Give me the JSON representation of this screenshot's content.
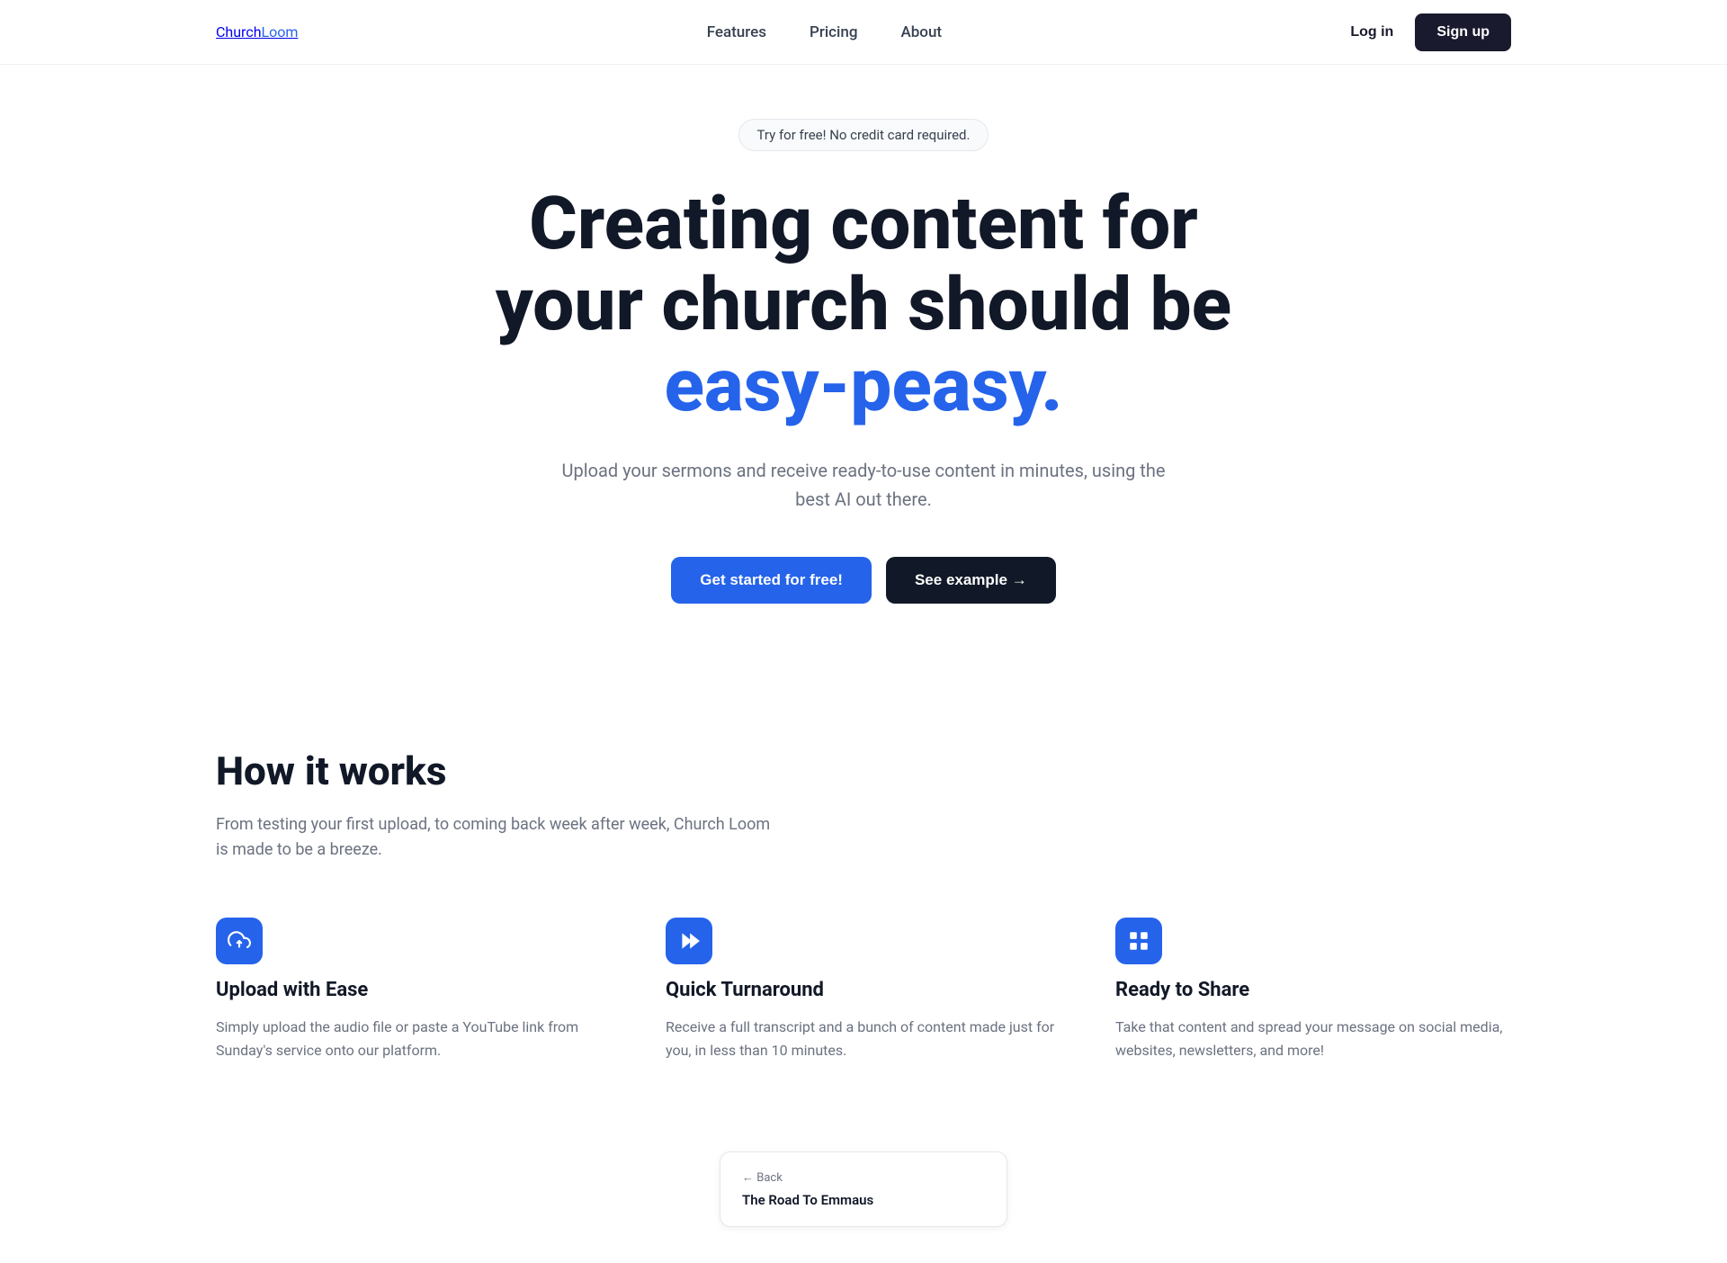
{
  "nav": {
    "logo_church": "Church",
    "logo_loom": "Loom",
    "links": [
      {
        "label": "Features",
        "href": "#features"
      },
      {
        "label": "Pricing",
        "href": "#pricing"
      },
      {
        "label": "About",
        "href": "#about"
      }
    ],
    "login_label": "Log in",
    "signup_label": "Sign up"
  },
  "hero": {
    "badge": "Try for free! No credit card required.",
    "title_part1": "Creating content for your church should be ",
    "title_highlight": "easy-peasy.",
    "subtitle": "Upload your sermons and receive ready-to-use content in minutes, using the best AI out there.",
    "cta_primary": "Get started for free!",
    "cta_secondary": "See example →"
  },
  "how": {
    "heading": "How it works",
    "description": "From testing your first upload, to coming back week after week, Church Loom is made to be a breeze.",
    "features": [
      {
        "icon": "upload-cloud",
        "title": "Upload with Ease",
        "description": "Simply upload the audio file or paste a YouTube link from Sunday's service onto our platform."
      },
      {
        "icon": "fast-forward",
        "title": "Quick Turnaround",
        "description": "Receive a full transcript and a bunch of content made just for you, in less than 10 minutes."
      },
      {
        "icon": "share",
        "title": "Ready to Share",
        "description": "Take that content and spread your message on social media, websites, newsletters, and more!"
      }
    ]
  },
  "preview": {
    "back_label": "← Back",
    "card_title": "The Road To Emmaus"
  }
}
